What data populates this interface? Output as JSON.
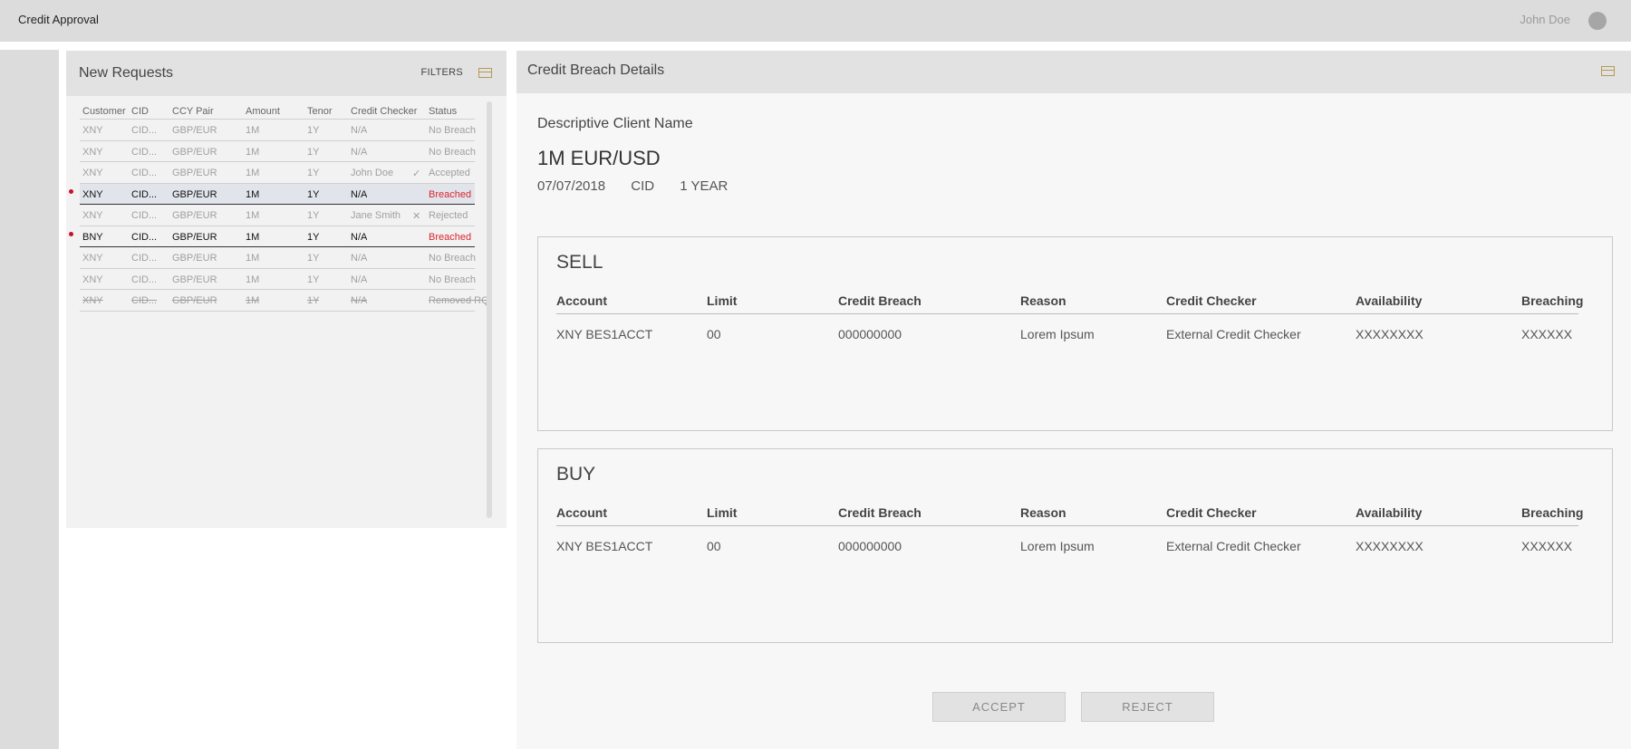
{
  "app": {
    "title": "Credit Approval",
    "user_name": "John Doe"
  },
  "requests": {
    "title": "New Requests",
    "filters_label": "FILTERS",
    "columns": [
      "Customer",
      "CID",
      "CCY Pair",
      "Amount",
      "Tenor",
      "Credit Checker",
      "Status"
    ],
    "rows": [
      {
        "customer": "XNY",
        "cid": "CID...",
        "ccy": "GBP/EUR",
        "amount": "1M",
        "tenor": "1Y",
        "checker": "N/A",
        "status": "No Breach",
        "state": "normal",
        "icon": ""
      },
      {
        "customer": "XNY",
        "cid": "CID...",
        "ccy": "GBP/EUR",
        "amount": "1M",
        "tenor": "1Y",
        "checker": "N/A",
        "status": "No Breach",
        "state": "normal",
        "icon": ""
      },
      {
        "customer": "XNY",
        "cid": "CID...",
        "ccy": "GBP/EUR",
        "amount": "1M",
        "tenor": "1Y",
        "checker": "John Doe",
        "status": "Accepted",
        "state": "normal",
        "icon": "check-icon"
      },
      {
        "customer": "XNY",
        "cid": "CID...",
        "ccy": "GBP/EUR",
        "amount": "1M",
        "tenor": "1Y",
        "checker": "N/A",
        "status": "Breached",
        "state": "breached-selected",
        "icon": ""
      },
      {
        "customer": "XNY",
        "cid": "CID...",
        "ccy": "GBP/EUR",
        "amount": "1M",
        "tenor": "1Y",
        "checker": "Jane Smith",
        "status": "Rejected",
        "state": "normal",
        "icon": "x-icon"
      },
      {
        "customer": "BNY",
        "cid": "CID...",
        "ccy": "GBP/EUR",
        "amount": "1M",
        "tenor": "1Y",
        "checker": "N/A",
        "status": "Breached",
        "state": "breached",
        "icon": ""
      },
      {
        "customer": "XNY",
        "cid": "CID...",
        "ccy": "GBP/EUR",
        "amount": "1M",
        "tenor": "1Y",
        "checker": "N/A",
        "status": "No Breach",
        "state": "normal",
        "icon": ""
      },
      {
        "customer": "XNY",
        "cid": "CID...",
        "ccy": "GBP/EUR",
        "amount": "1M",
        "tenor": "1Y",
        "checker": "N/A",
        "status": "No Breach",
        "state": "normal",
        "icon": ""
      },
      {
        "customer": "XNY",
        "cid": "CID...",
        "ccy": "GBP/EUR",
        "amount": "1M",
        "tenor": "1Y",
        "checker": "N/A",
        "status": "Removed RQ",
        "state": "removed",
        "icon": ""
      }
    ]
  },
  "details": {
    "title": "Credit Breach Details",
    "client_name": "Descriptive Client Name",
    "deal": "1M EUR/USD",
    "date": "07/07/2018",
    "cid": "CID",
    "tenor": "1 YEAR",
    "columns": [
      "Account",
      "Limit",
      "Credit Breach",
      "Reason",
      "Credit Checker",
      "Availability",
      "Breaching"
    ],
    "sell": {
      "title": "SELL",
      "row": [
        "XNY BES1ACCT",
        "00",
        "000000000",
        "Lorem Ipsum",
        "External Credit Checker",
        "XXXXXXXX",
        "XXXXXX"
      ]
    },
    "buy": {
      "title": "BUY",
      "row": [
        "XNY BES1ACCT",
        "00",
        "000000000",
        "Lorem Ipsum",
        "External Credit Checker",
        "XXXXXXXX",
        "XXXXXX"
      ]
    },
    "accept_label": "ACCEPT",
    "reject_label": "REJECT"
  },
  "colors": {
    "breached": "#d9262e",
    "dot": "#c8102e",
    "selected_row": "#e2e4ec",
    "icon_accent": "#b59a52"
  }
}
